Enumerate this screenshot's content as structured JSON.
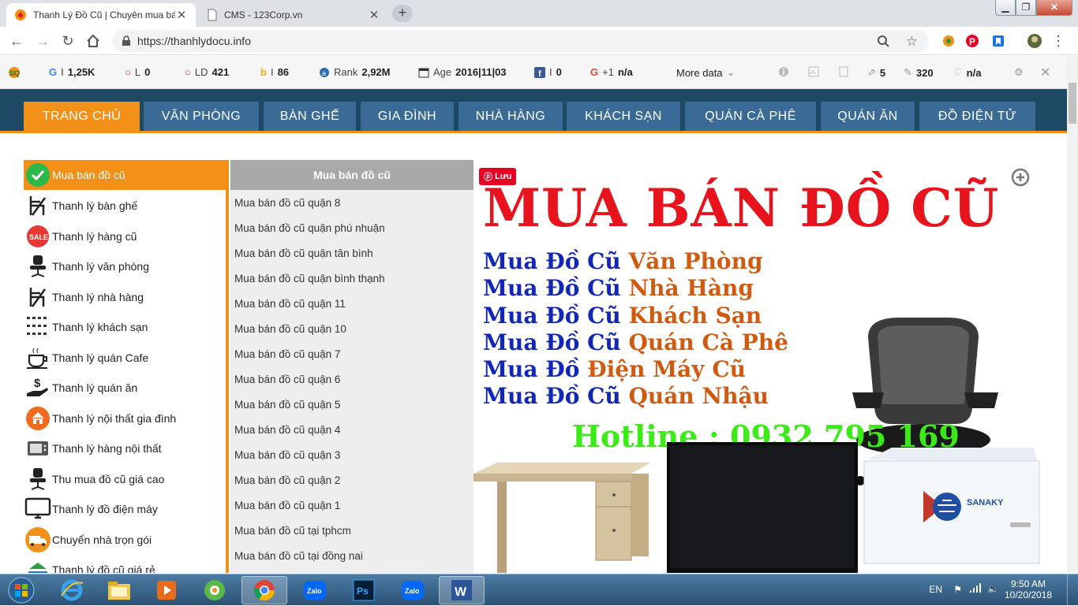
{
  "browser": {
    "tabs": [
      {
        "title": "Thanh Lý Đồ Cũ | Chuyên mua bá"
      },
      {
        "title": "CMS - 123Corp.vn"
      }
    ],
    "url": "https://thanhlydocu.info"
  },
  "seoquake": {
    "google_index": "1,25K",
    "links_l": "0",
    "ld": "421",
    "bing_index": "86",
    "rank_label": "Rank",
    "rank": "2,92M",
    "age_label": "Age",
    "age": "2016|11|03",
    "facebook": "0",
    "gplus_label": "+1",
    "gplus": "n/a",
    "more_data": "More data",
    "external_links": "5",
    "words": "320",
    "health": "n/a",
    "l_label": "L",
    "ld_label": "LD"
  },
  "nav": {
    "items": [
      {
        "label": "TRANG CHỦ"
      },
      {
        "label": "VĂN PHÒNG"
      },
      {
        "label": "BÀN GHẾ"
      },
      {
        "label": "GIA ĐÌNH"
      },
      {
        "label": "NHÀ HÀNG"
      },
      {
        "label": "KHÁCH SẠN"
      },
      {
        "label": "QUÁN CÀ PHÊ"
      },
      {
        "label": "QUÁN ĂN"
      },
      {
        "label": "ĐỒ ĐIỆN TỬ"
      }
    ],
    "active_color": "#f39018",
    "item_color": "#3a6b96",
    "band_color": "#1d4965"
  },
  "left_menu": {
    "items": [
      {
        "label": "Mua bán đồ cũ",
        "icon": "checkmark-icon"
      },
      {
        "label": "Thanh lý bàn ghế",
        "icon": "chair-icon"
      },
      {
        "label": "Thanh lý hàng cũ",
        "icon": "sale-icon"
      },
      {
        "label": "Thanh lý văn phòng",
        "icon": "office-chair-icon"
      },
      {
        "label": "Thanh lý nhà hàng",
        "icon": "chair-icon"
      },
      {
        "label": "Thanh lý khách sạn",
        "icon": "furniture-set-icon"
      },
      {
        "label": "Thanh lý quán Cafe",
        "icon": "coffee-cup-icon"
      },
      {
        "label": "Thanh lý quán ăn",
        "icon": "money-hand-icon"
      },
      {
        "label": "Thanh lý nội thất gia đình",
        "icon": "home-icon"
      },
      {
        "label": "Thanh lý hàng nội thất",
        "icon": "microwave-icon"
      },
      {
        "label": "Thu mua đồ cũ giá cao",
        "icon": "office-chair-icon"
      },
      {
        "label": "Thanh lý đồ điện máy",
        "icon": "monitor-icon"
      },
      {
        "label": "Chuyển nhà trọn gói",
        "icon": "truck-icon"
      },
      {
        "label": "Thanh lý đồ cũ giá rẻ",
        "icon": "logo-icon"
      }
    ]
  },
  "mid_list": {
    "header": "Mua bán đồ cũ",
    "items": [
      "Mua bán đồ cũ quận 8",
      "Mua bán đồ cũ quận phú nhuận",
      "Mua bán đồ cũ quận tân bình",
      "Mua bán đồ cũ quận bình thạnh",
      "Mua bán đồ cũ quận 11",
      "Mua bán đồ cũ quận 10",
      "Mua bán đồ cũ quận 7",
      "Mua bán đồ cũ quận 6",
      "Mua bán đồ cũ quận 5",
      "Mua bán đồ cũ quận 4",
      "Mua bán đồ cũ quận 3",
      "Mua bán đồ cũ quận 2",
      "Mua bán đồ cũ quận 1",
      "Mua bán đồ cũ tại tphcm",
      "Mua bán đồ cũ tại đồng nai"
    ]
  },
  "banner": {
    "pin_label": "Lưu",
    "title": "MUA BÁN ĐỒ CŨ",
    "lines": [
      {
        "a": "Mua Đồ Cũ",
        "b": "Văn Phòng"
      },
      {
        "a": "Mua Đồ Cũ",
        "b": "Nhà Hàng"
      },
      {
        "a": "Mua Đồ Cũ",
        "b": "Khách Sạn"
      },
      {
        "a": "Mua Đồ Cũ",
        "b": "Quán Cà Phê"
      },
      {
        "a": "Mua Đồ",
        "b": "Điện Máy Cũ"
      },
      {
        "a": "Mua Đồ Cũ",
        "b": "Quán Nhậu"
      }
    ],
    "hotline": "Hotline : 0932 795 169",
    "freezer_brand": "SANAKY"
  },
  "taskbar": {
    "apps": [
      "ie-icon",
      "explorer-icon",
      "media-player-icon",
      "coccoc-icon",
      "chrome-icon",
      "zalo-icon",
      "photoshop-icon",
      "zalo-icon",
      "word-icon"
    ],
    "lang": "EN",
    "time": "9:50 AM",
    "date": "10/20/2018"
  }
}
